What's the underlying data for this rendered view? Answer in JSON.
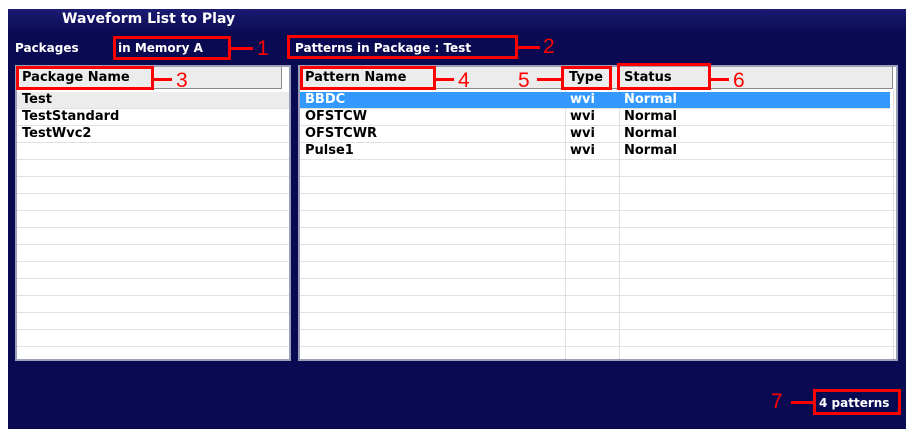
{
  "window": {
    "title": "Waveform List to Play"
  },
  "packages_label": "Packages",
  "memory_label": "in Memory  A",
  "patterns_in_package": "Patterns in Package : Test",
  "package_list": {
    "header": "Package Name",
    "items": [
      "Test",
      "TestStandard",
      "TestWvc2"
    ],
    "selected_index": 0
  },
  "pattern_table": {
    "columns": [
      "Pattern Name",
      "Type",
      "Status"
    ],
    "rows": [
      [
        "BBDC",
        "wvi",
        "Normal"
      ],
      [
        "OFSTCW",
        "wvi",
        "Normal"
      ],
      [
        "OFSTCWR",
        "wvi",
        "Normal"
      ],
      [
        "Pulse1",
        "wvi",
        "Normal"
      ]
    ],
    "selected_index": 0
  },
  "pattern_count": "4 patterns",
  "callouts": [
    "1",
    "2",
    "3",
    "4",
    "5",
    "6",
    "7"
  ],
  "colors": {
    "background": "#0a0a52",
    "callout": "#ff0000",
    "selection": "#3399ff"
  }
}
